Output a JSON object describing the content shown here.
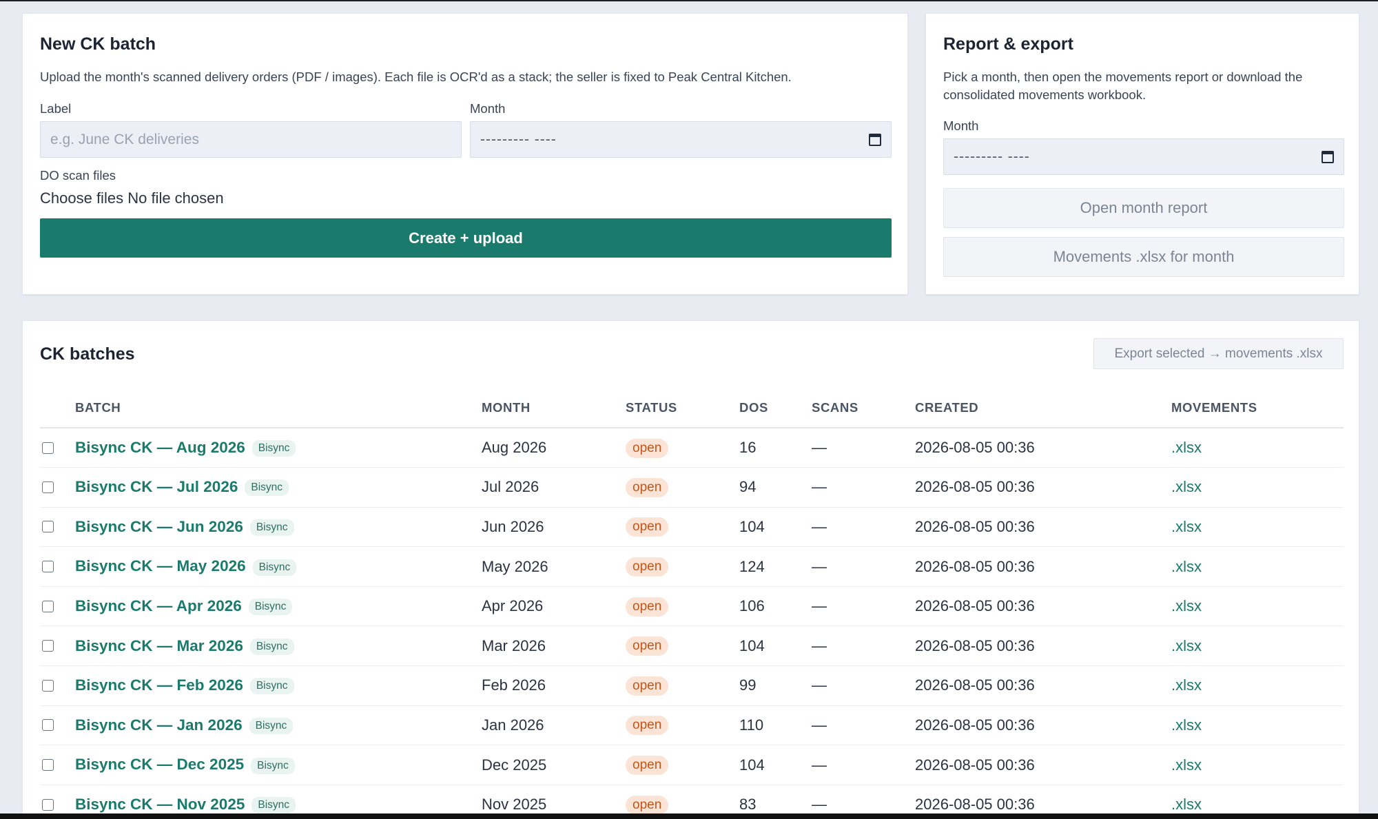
{
  "new_batch": {
    "title": "New CK batch",
    "description": "Upload the month's scanned delivery orders (PDF / images). Each file is OCR'd as a stack; the seller is fixed to Peak Central Kitchen.",
    "label_label": "Label",
    "label_placeholder": "e.g. June CK deliveries",
    "month_label": "Month",
    "month_value": "--------- ----",
    "files_label": "DO scan files",
    "choose_files": "Choose files",
    "no_file": "No file chosen",
    "submit": "Create + upload"
  },
  "report": {
    "title": "Report & export",
    "description": "Pick a month, then open the movements report or download the consolidated movements workbook.",
    "month_label": "Month",
    "month_value": "--------- ----",
    "open_report": "Open month report",
    "download_xlsx": "Movements .xlsx for month"
  },
  "batches": {
    "title": "CK batches",
    "export_selected": "Export selected → movements .xlsx",
    "columns": [
      "BATCH",
      "MONTH",
      "STATUS",
      "DOS",
      "SCANS",
      "CREATED",
      "MOVEMENTS"
    ],
    "rows": [
      {
        "name": "Bisync CK — Aug 2026",
        "tag": "Bisync",
        "month": "Aug 2026",
        "status": "open",
        "dos": "16",
        "scans": "—",
        "created": "2026-08-05 00:36",
        "movements": ".xlsx"
      },
      {
        "name": "Bisync CK — Jul 2026",
        "tag": "Bisync",
        "month": "Jul 2026",
        "status": "open",
        "dos": "94",
        "scans": "—",
        "created": "2026-08-05 00:36",
        "movements": ".xlsx"
      },
      {
        "name": "Bisync CK — Jun 2026",
        "tag": "Bisync",
        "month": "Jun 2026",
        "status": "open",
        "dos": "104",
        "scans": "—",
        "created": "2026-08-05 00:36",
        "movements": ".xlsx"
      },
      {
        "name": "Bisync CK — May 2026",
        "tag": "Bisync",
        "month": "May 2026",
        "status": "open",
        "dos": "124",
        "scans": "—",
        "created": "2026-08-05 00:36",
        "movements": ".xlsx"
      },
      {
        "name": "Bisync CK — Apr 2026",
        "tag": "Bisync",
        "month": "Apr 2026",
        "status": "open",
        "dos": "106",
        "scans": "—",
        "created": "2026-08-05 00:36",
        "movements": ".xlsx"
      },
      {
        "name": "Bisync CK — Mar 2026",
        "tag": "Bisync",
        "month": "Mar 2026",
        "status": "open",
        "dos": "104",
        "scans": "—",
        "created": "2026-08-05 00:36",
        "movements": ".xlsx"
      },
      {
        "name": "Bisync CK — Feb 2026",
        "tag": "Bisync",
        "month": "Feb 2026",
        "status": "open",
        "dos": "99",
        "scans": "—",
        "created": "2026-08-05 00:36",
        "movements": ".xlsx"
      },
      {
        "name": "Bisync CK — Jan 2026",
        "tag": "Bisync",
        "month": "Jan 2026",
        "status": "open",
        "dos": "110",
        "scans": "—",
        "created": "2026-08-05 00:36",
        "movements": ".xlsx"
      },
      {
        "name": "Bisync CK — Dec 2025",
        "tag": "Bisync",
        "month": "Dec 2025",
        "status": "open",
        "dos": "104",
        "scans": "—",
        "created": "2026-08-05 00:36",
        "movements": ".xlsx"
      },
      {
        "name": "Bisync CK — Nov 2025",
        "tag": "Bisync",
        "month": "Nov 2025",
        "status": "open",
        "dos": "83",
        "scans": "—",
        "created": "2026-08-05 00:36",
        "movements": ".xlsx"
      }
    ]
  },
  "colors": {
    "accent": "#1a7a6b",
    "background": "#e8ebf2",
    "status_open_bg": "#fbe4d6",
    "status_open_text": "#c2551b"
  }
}
